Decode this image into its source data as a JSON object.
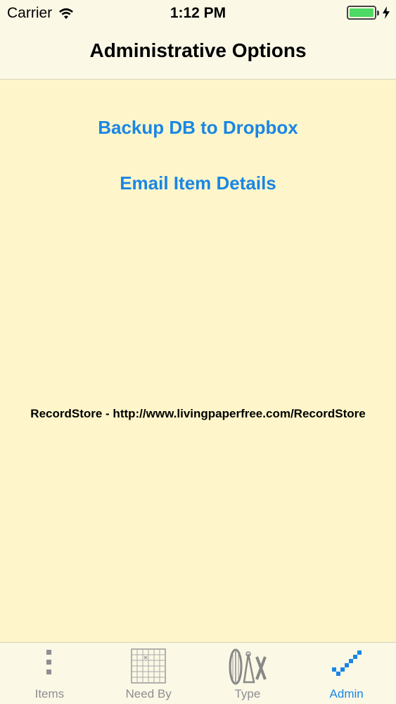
{
  "status_bar": {
    "carrier": "Carrier",
    "time": "1:12 PM",
    "battery_color": "#4cd964"
  },
  "nav": {
    "title": "Administrative Options"
  },
  "actions": {
    "backup_label": "Backup DB to Dropbox",
    "email_label": "Email Item Details"
  },
  "footer": {
    "url_text": "RecordStore - http://www.livingpaperfree.com/RecordStore"
  },
  "tabs": [
    {
      "label": "Items",
      "icon": "dots-icon"
    },
    {
      "label": "Need By",
      "icon": "calendar-grid-icon"
    },
    {
      "label": "Type",
      "icon": "instruments-icon"
    },
    {
      "label": "Admin",
      "icon": "checkmark-icon",
      "active": true
    }
  ],
  "colors": {
    "accent": "#1a86e4",
    "background": "#fef6ca",
    "bar": "#fbf8e6"
  }
}
